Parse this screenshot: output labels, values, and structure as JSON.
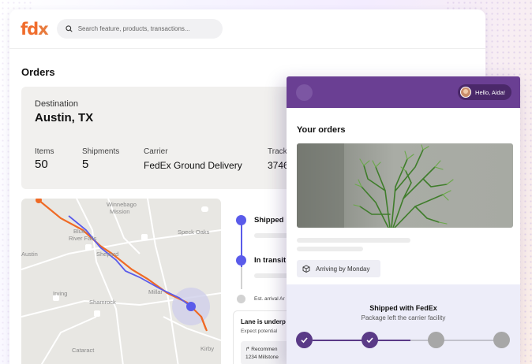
{
  "app": {
    "logo_left": "fd",
    "logo_right": "x",
    "search_placeholder": "Search feature, products, transactions...",
    "page_title": "Orders"
  },
  "summary": {
    "destination_label": "Destination",
    "destination_value": "Austin, TX",
    "items_label": "Items",
    "items_value": "50",
    "shipments_label": "Shipments",
    "shipments_value": "5",
    "carrier_label": "Carrier",
    "carrier_value": "FedEx Ground Delivery",
    "tracking_label": "Track",
    "tracking_value": "3746"
  },
  "map": {
    "labels": [
      "Winnebago",
      "Mission",
      "Blue",
      "River Falls",
      "Austin",
      "Shepard",
      "Speck Oaks",
      "Irving",
      "Shamrock",
      "Millar",
      "Cataract",
      "Kirby"
    ],
    "route_colors": {
      "primary": "#ef6a25",
      "secondary": "#5a5bea"
    }
  },
  "timeline": {
    "steps": [
      {
        "title": "Shipped"
      },
      {
        "title": "In transit"
      },
      {
        "title": "Est. arrival Ar"
      }
    ],
    "lane_title": "Lane is underp",
    "lane_sub": "Expect potential",
    "reco_label": "Recommen",
    "reco_address": "1234 Millstone"
  },
  "phone": {
    "greeting": "Hello, Aida!",
    "section_title": "Your orders",
    "arrival_chip": "Arriving by Monday",
    "ship_title": "Shipped with FedEx",
    "ship_subtitle": "Package left the carrier facility",
    "progress": {
      "completed_steps": 2,
      "total_steps": 4
    }
  },
  "colors": {
    "brand_purple": "#6a3f93",
    "accent_blue": "#5a5bea",
    "brand_orange": "#f06c2c"
  }
}
